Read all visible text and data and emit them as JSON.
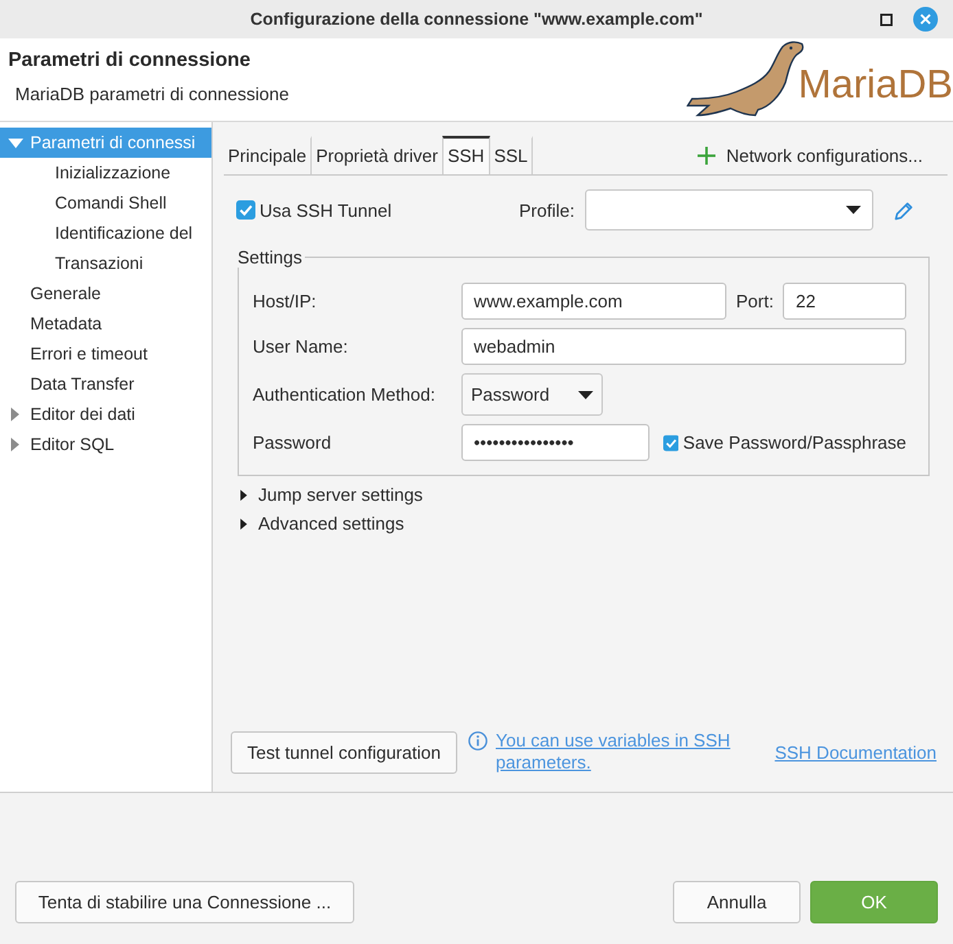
{
  "window": {
    "title": "Configurazione della connessione \"www.example.com\""
  },
  "header": {
    "title": "Parametri di connessione",
    "subtitle": "MariaDB parametri di connessione",
    "logo_text": "MariaDB"
  },
  "sidebar": {
    "items": [
      {
        "label": "Parametri di connessi",
        "selected": true,
        "expanded": true,
        "children": [
          {
            "label": "Inizializzazione",
            "selected": false
          },
          {
            "label": "Comandi Shell",
            "selected": false
          },
          {
            "label": "Identificazione del",
            "selected": false
          },
          {
            "label": "Transazioni",
            "selected": false
          }
        ]
      },
      {
        "label": "Generale",
        "selected": false
      },
      {
        "label": "Metadata",
        "selected": false
      },
      {
        "label": "Errori e timeout",
        "selected": false
      },
      {
        "label": "Data Transfer",
        "selected": false
      },
      {
        "label": "Editor dei dati",
        "selected": false,
        "expanded": false
      },
      {
        "label": "Editor SQL",
        "selected": false,
        "expanded": false
      }
    ]
  },
  "tabs": [
    {
      "label": "Principale",
      "selected": false
    },
    {
      "label": "Proprietà driver",
      "selected": false
    },
    {
      "label": "SSH",
      "selected": true
    },
    {
      "label": "SSL",
      "selected": false
    }
  ],
  "network_button": {
    "label": "Network configurations..."
  },
  "tunnel": {
    "label": "Usa SSH Tunnel",
    "checked": true
  },
  "profile": {
    "label": "Profile:"
  },
  "settings": {
    "title": "Settings",
    "host": {
      "label": "Host/IP:",
      "value": "www.example.com"
    },
    "port": {
      "label": "Port:",
      "value": "22"
    },
    "user_name": {
      "label": "User Name:",
      "value": "webadmin"
    },
    "auth_method": {
      "label": "Authentication Method:",
      "value": "Password"
    },
    "password": {
      "label": "Password",
      "value": "••••••••••••••••"
    },
    "save_password": {
      "label": "Save Password/Passphrase",
      "checked": true
    }
  },
  "sections": [
    {
      "label": "Jump server settings",
      "expanded": false
    },
    {
      "label": "Advanced settings",
      "expanded": false
    }
  ],
  "test_button": {
    "label": "Test tunnel configuration"
  },
  "variables_link": {
    "label": "You can use variables in SSH parameters."
  },
  "docs_link": {
    "label": "SSH Documentation"
  },
  "dialog_buttons": {
    "left": [
      {
        "label": "Tenta di stabilire una Connessione ...",
        "kind": "secondary"
      }
    ],
    "right": [
      {
        "label": "Annulla",
        "kind": "secondary"
      },
      {
        "label": "OK",
        "kind": "primary"
      }
    ]
  }
}
